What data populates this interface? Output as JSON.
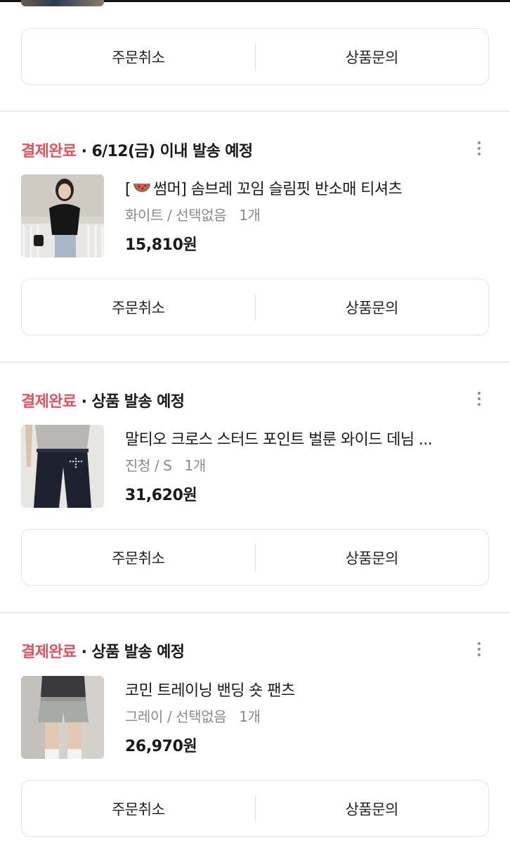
{
  "buttons": {
    "cancel": "주문취소",
    "inquiry": "상품문의"
  },
  "orders": [
    {
      "status": "결제완료",
      "shipping_note": "· 6/12(금) 이내 발송 예정",
      "name_prefix": "[",
      "name_emoji_icon": "watermelon-icon",
      "name": "썸머] 솜브레 꼬임 슬림핏 반소매 티셔츠",
      "option": "화이트 / 선택없음",
      "qty": "1개",
      "price": "15,810원"
    },
    {
      "status": "결제완료",
      "shipping_note": "· 상품 발송 예정",
      "name": "말티오 크로스 스터드 포인트 벌룬 와이드 데님 ...",
      "option": "진청 / S",
      "qty": "1개",
      "price": "31,620원"
    },
    {
      "status": "결제완료",
      "shipping_note": "· 상품 발송 예정",
      "name": "코민 트레이닝 밴딩 숏 팬츠",
      "option": "그레이 / 선택없음",
      "qty": "1개",
      "price": "26,970원"
    }
  ],
  "colors": {
    "status_red": "#e8505b",
    "border": "#e4e4e4",
    "muted": "#8a8a8a"
  }
}
